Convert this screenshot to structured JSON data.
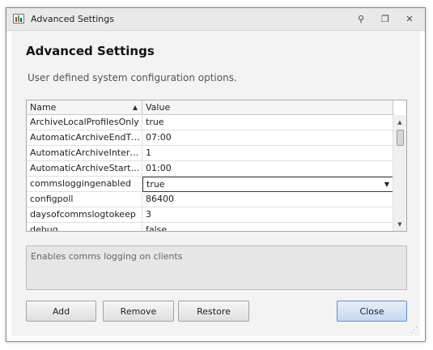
{
  "window": {
    "title": "Advanced Settings",
    "controls": {
      "pin": "⚲",
      "restore": "❐",
      "close": "✕"
    }
  },
  "header": {
    "title": "Advanced Settings",
    "subtitle": "User defined system configuration options."
  },
  "grid": {
    "columns": [
      "Name",
      "Value"
    ],
    "sort_indicator": "▲",
    "rows": [
      {
        "name": "ArchiveLocalProfilesOnly",
        "value": "true"
      },
      {
        "name": "AutomaticArchiveEndTime",
        "value": "07:00"
      },
      {
        "name": "AutomaticArchiveIntervalDays",
        "value": "1"
      },
      {
        "name": "AutomaticArchiveStartTime",
        "value": "01:00"
      },
      {
        "name": "commsloggingenabled",
        "value": "true",
        "selected": true
      },
      {
        "name": "configpoll",
        "value": "86400"
      },
      {
        "name": "daysofcommslogtokeep",
        "value": "3"
      },
      {
        "name": "debug",
        "value": "false"
      }
    ],
    "dropdown_arrow": "▼",
    "scroll_up": "▲",
    "scroll_down": "▼"
  },
  "description": "Enables comms logging on clients",
  "buttons": {
    "add": "Add",
    "remove": "Remove",
    "restore": "Restore",
    "close": "Close"
  },
  "colors": {
    "primary_button": "#c5d8f1",
    "title_bar": "#e9e9e9",
    "panel": "#f3f3f3"
  }
}
